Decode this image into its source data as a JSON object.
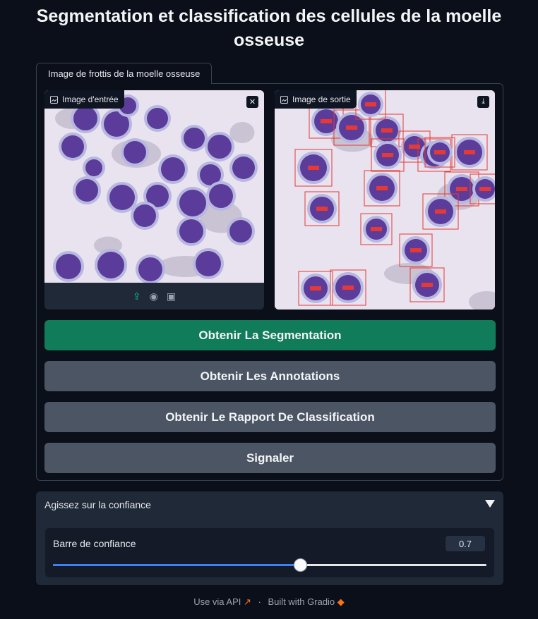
{
  "app": {
    "title": "Segmentation et classification des cellules de la moelle osseuse"
  },
  "tab": {
    "label": "Image de frottis de la moelle osseuse"
  },
  "input_image": {
    "label": "Image d'entrée",
    "icons": [
      "image-icon",
      "close-icon",
      "upload-icon",
      "webcam-icon",
      "clipboard-icon"
    ]
  },
  "output_image": {
    "label": "Image de sortie",
    "icons": [
      "image-icon",
      "download-icon"
    ],
    "box_tag": "cell"
  },
  "buttons": {
    "segmentation": "Obtenir La Segmentation",
    "annotations": "Obtenir Les Annotations",
    "report": "Obtenir Le Rapport De Classification",
    "report_issue": "Signaler"
  },
  "accordion": {
    "title": "Agissez sur la confiance",
    "slider": {
      "label": "Barre de confiance",
      "value": "0.7",
      "level": 0.57
    }
  },
  "footer": {
    "api": "Use via API",
    "built": "Built with Gradio"
  },
  "colors": {
    "background": "#0b0f19",
    "primary_button": "#117c5a",
    "secondary_button": "#4b5563",
    "slider_fill": "#3b82f6",
    "box": "#e53935",
    "nucleus": "#5b3c9a",
    "smear": "#e8e3ef"
  }
}
